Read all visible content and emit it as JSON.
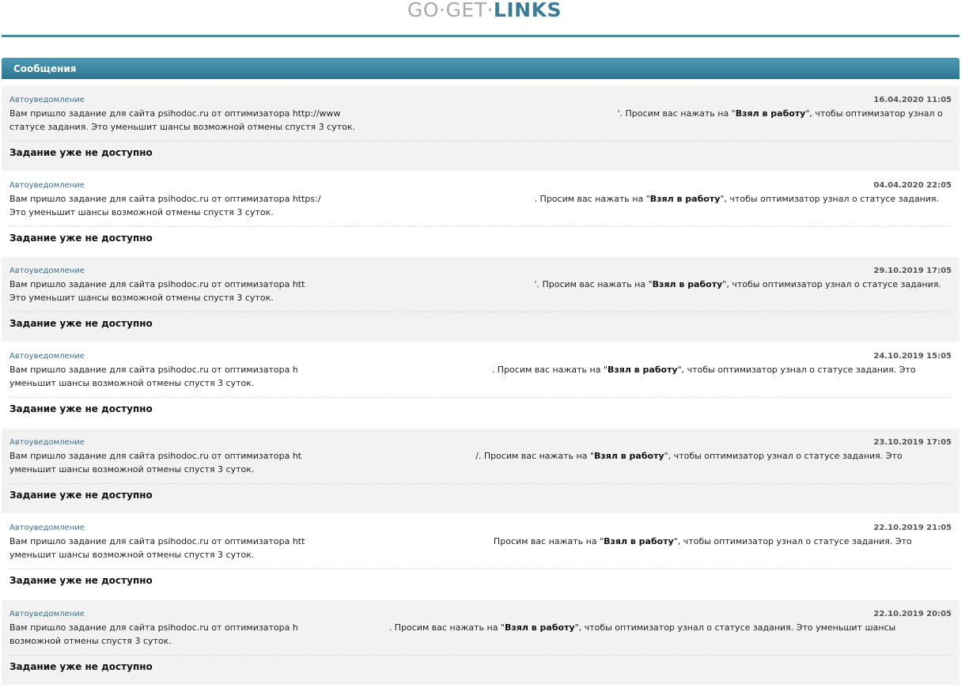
{
  "logo": {
    "part1": "GO·GET·",
    "part2": "LINKS"
  },
  "section": {
    "title": "Сообщения"
  },
  "messages": [
    {
      "sender": "Автоуведомление",
      "date": "16.04.2020 11:05",
      "text_before": "Вам пришло задание для сайта psihodoc.ru от оптимизатора http://www",
      "text_after": "'. Просим вас нажать на \"",
      "bold": "Взял в работу",
      "text_end": "\", чтобы оптимизатор узнал о статусе задания. Это уменьшит шансы возможной отмены спустя 3 суток.",
      "status": "Задание уже не доступно"
    },
    {
      "sender": "Автоуведомление",
      "date": "04.04.2020 22:05",
      "text_before": "Вам пришло задание для сайта psihodoc.ru от оптимизатора https:/",
      "text_after": ". Просим вас нажать на \"",
      "bold": "Взял в работу",
      "text_end": "\", чтобы оптимизатор узнал о статусе задания. Это уменьшит шансы возможной отмены спустя 3 суток.",
      "status": "Задание уже не доступно"
    },
    {
      "sender": "Автоуведомление",
      "date": "29.10.2019 17:05",
      "text_before": "Вам пришло задание для сайта psihodoc.ru от оптимизатора htt",
      "text_after": "'. Просим вас нажать на \"",
      "bold": "Взял в работу",
      "text_end": "\", чтобы оптимизатор узнал о статусе задания. Это уменьшит шансы возможной отмены спустя 3 суток.",
      "status": "Задание уже не доступно"
    },
    {
      "sender": "Автоуведомление",
      "date": "24.10.2019 15:05",
      "text_before": "Вам пришло задание для сайта psihodoc.ru от оптимизатора h",
      "text_after": ". Просим вас нажать на \"",
      "bold": "Взял в работу",
      "text_end": "\", чтобы оптимизатор узнал о статусе задания. Это уменьшит шансы возможной отмены спустя 3 суток.",
      "status": "Задание уже не доступно"
    },
    {
      "sender": "Автоуведомление",
      "date": "23.10.2019 17:05",
      "text_before": "Вам пришло задание для сайта psihodoc.ru от оптимизатора ht",
      "text_after": "/. Просим вас нажать на \"",
      "bold": "Взял в работу",
      "text_end": "\", чтобы оптимизатор узнал о статусе задания. Это уменьшит шансы возможной отмены спустя 3 суток.",
      "status": "Задание уже не доступно"
    },
    {
      "sender": "Автоуведомление",
      "date": "22.10.2019 21:05",
      "text_before": "Вам пришло задание для сайта psihodoc.ru от оптимизатора htt",
      "text_after": " Просим вас нажать на \"",
      "bold": "Взял в работу",
      "text_end": "\", чтобы оптимизатор узнал о статусе задания. Это уменьшит шансы возможной отмены спустя 3 суток.",
      "status": "Задание уже не доступно"
    },
    {
      "sender": "Автоуведомление",
      "date": "22.10.2019 20:05",
      "text_before": "Вам пришло задание для сайта psihodoc.ru от оптимизатора h",
      "text_after": ". Просим вас нажать на \"",
      "bold": "Взял в работу",
      "text_end": "\", чтобы оптимизатор узнал о статусе задания. Это уменьшит шансы возможной отмены спустя 3 суток.",
      "status": "Задание уже не доступно"
    }
  ]
}
